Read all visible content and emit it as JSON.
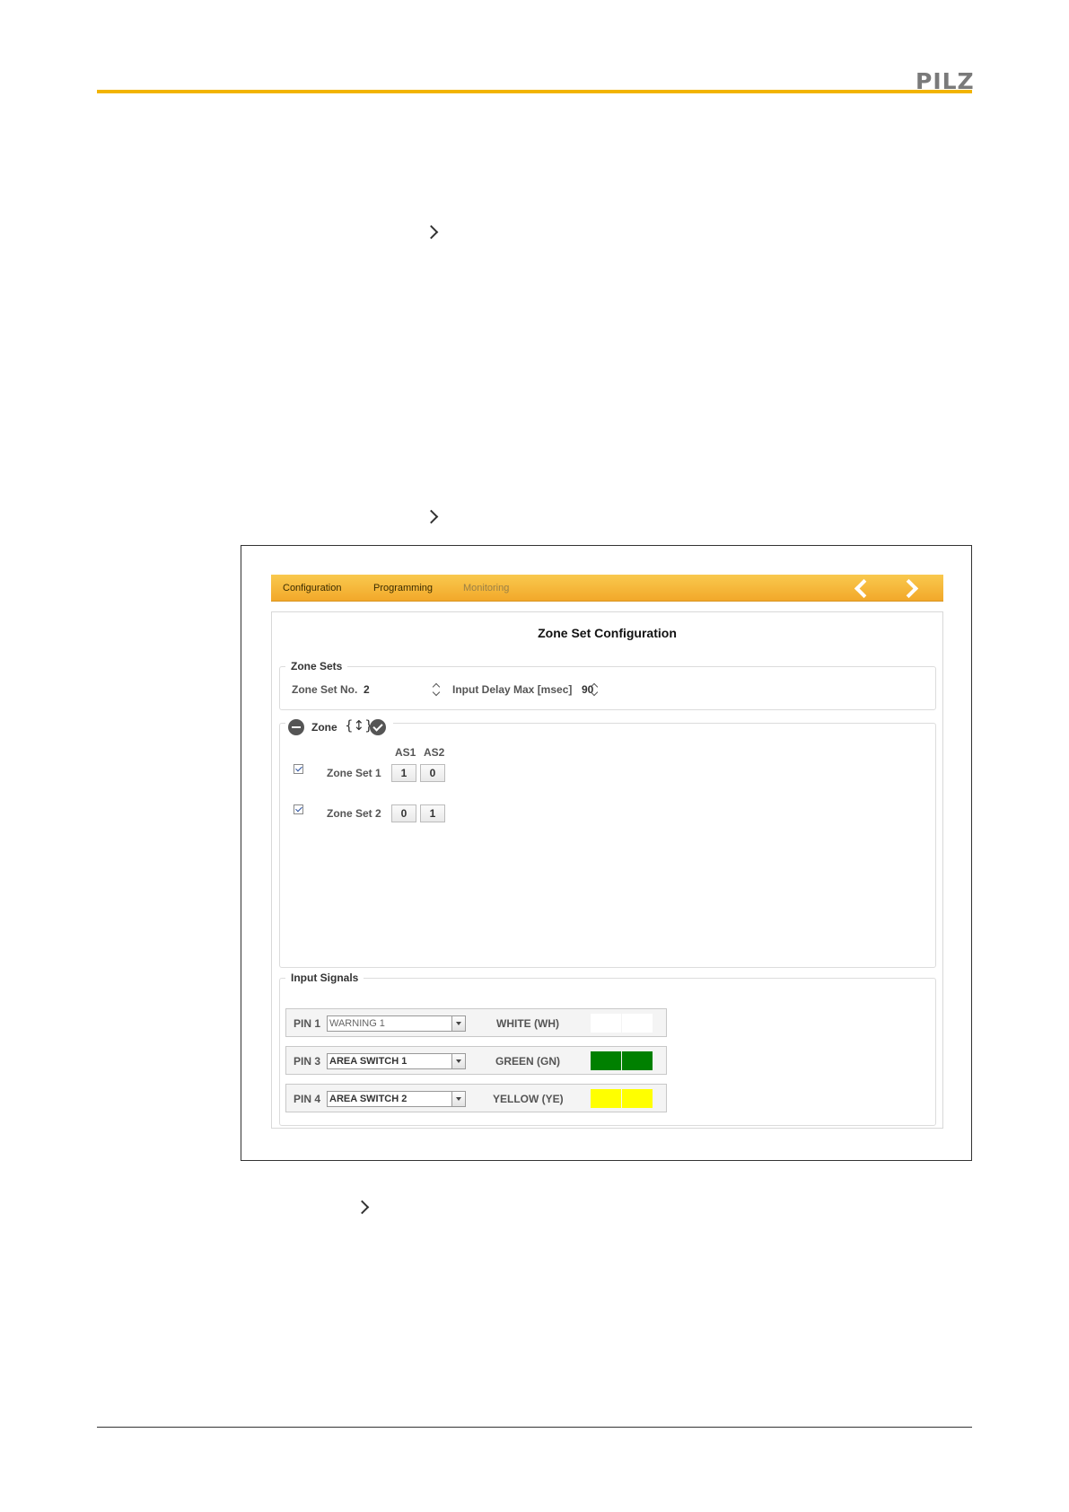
{
  "brand": {
    "logo": "PILZ"
  },
  "app": {
    "tabs": [
      {
        "label": "Configuration",
        "active": true
      },
      {
        "label": "Programming",
        "active": true
      },
      {
        "label": "Monitoring",
        "active": false
      }
    ],
    "nav": {
      "back_icon": "chevron-left-icon",
      "forward_icon": "chevron-right-icon"
    },
    "title": "Zone Set Configuration",
    "zone_sets": {
      "legend": "Zone Sets",
      "zone_set_no_label": "Zone Set No.",
      "zone_set_no_value": "2",
      "input_delay_label": "Input Delay Max [msec]",
      "input_delay_value": "90"
    },
    "zone": {
      "legend": "Zone",
      "brace": "{↕}",
      "columns": [
        "AS1",
        "AS2"
      ],
      "rows": [
        {
          "label": "Zone Set 1",
          "checked": true,
          "as1": "1",
          "as2": "0"
        },
        {
          "label": "Zone Set 2",
          "checked": true,
          "as1": "0",
          "as2": "1"
        }
      ]
    },
    "input_signals": {
      "legend": "Input Signals",
      "rows": [
        {
          "pin": "PIN 1",
          "function": "WARNING 1",
          "wire": "WHITE (WH)",
          "swatch": "#ffffff"
        },
        {
          "pin": "PIN 3",
          "function": "AREA SWITCH 1",
          "wire": "GREEN (GN)",
          "swatch": "#008000"
        },
        {
          "pin": "PIN 4",
          "function": "AREA SWITCH 2",
          "wire": "YELLOW (YE)",
          "swatch": "#ffff00"
        }
      ]
    }
  }
}
